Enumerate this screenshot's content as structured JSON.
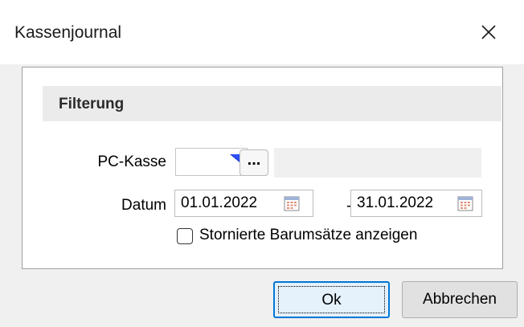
{
  "window": {
    "title": "Kassenjournal"
  },
  "filter_group": {
    "title": "Filterung"
  },
  "pc_kasse": {
    "label": "PC-Kasse",
    "value": "",
    "lookup_button_label": "...",
    "description": ""
  },
  "datum": {
    "label": "Datum",
    "from": "01.01.2022",
    "separator": "-",
    "to": "31.01.2022"
  },
  "show_cancelled": {
    "label": "Stornierte Barumsätze anzeigen",
    "checked": false
  },
  "buttons": {
    "ok": "Ok",
    "cancel": "Abbrechen"
  },
  "icons": {
    "close": "close-icon",
    "calendar": "calendar-icon",
    "marker": "input-marker-icon"
  },
  "colors": {
    "focus_border": "#0078d7",
    "marker_blue": "#1e3bd6",
    "group_header_bg": "#ebebeb"
  }
}
